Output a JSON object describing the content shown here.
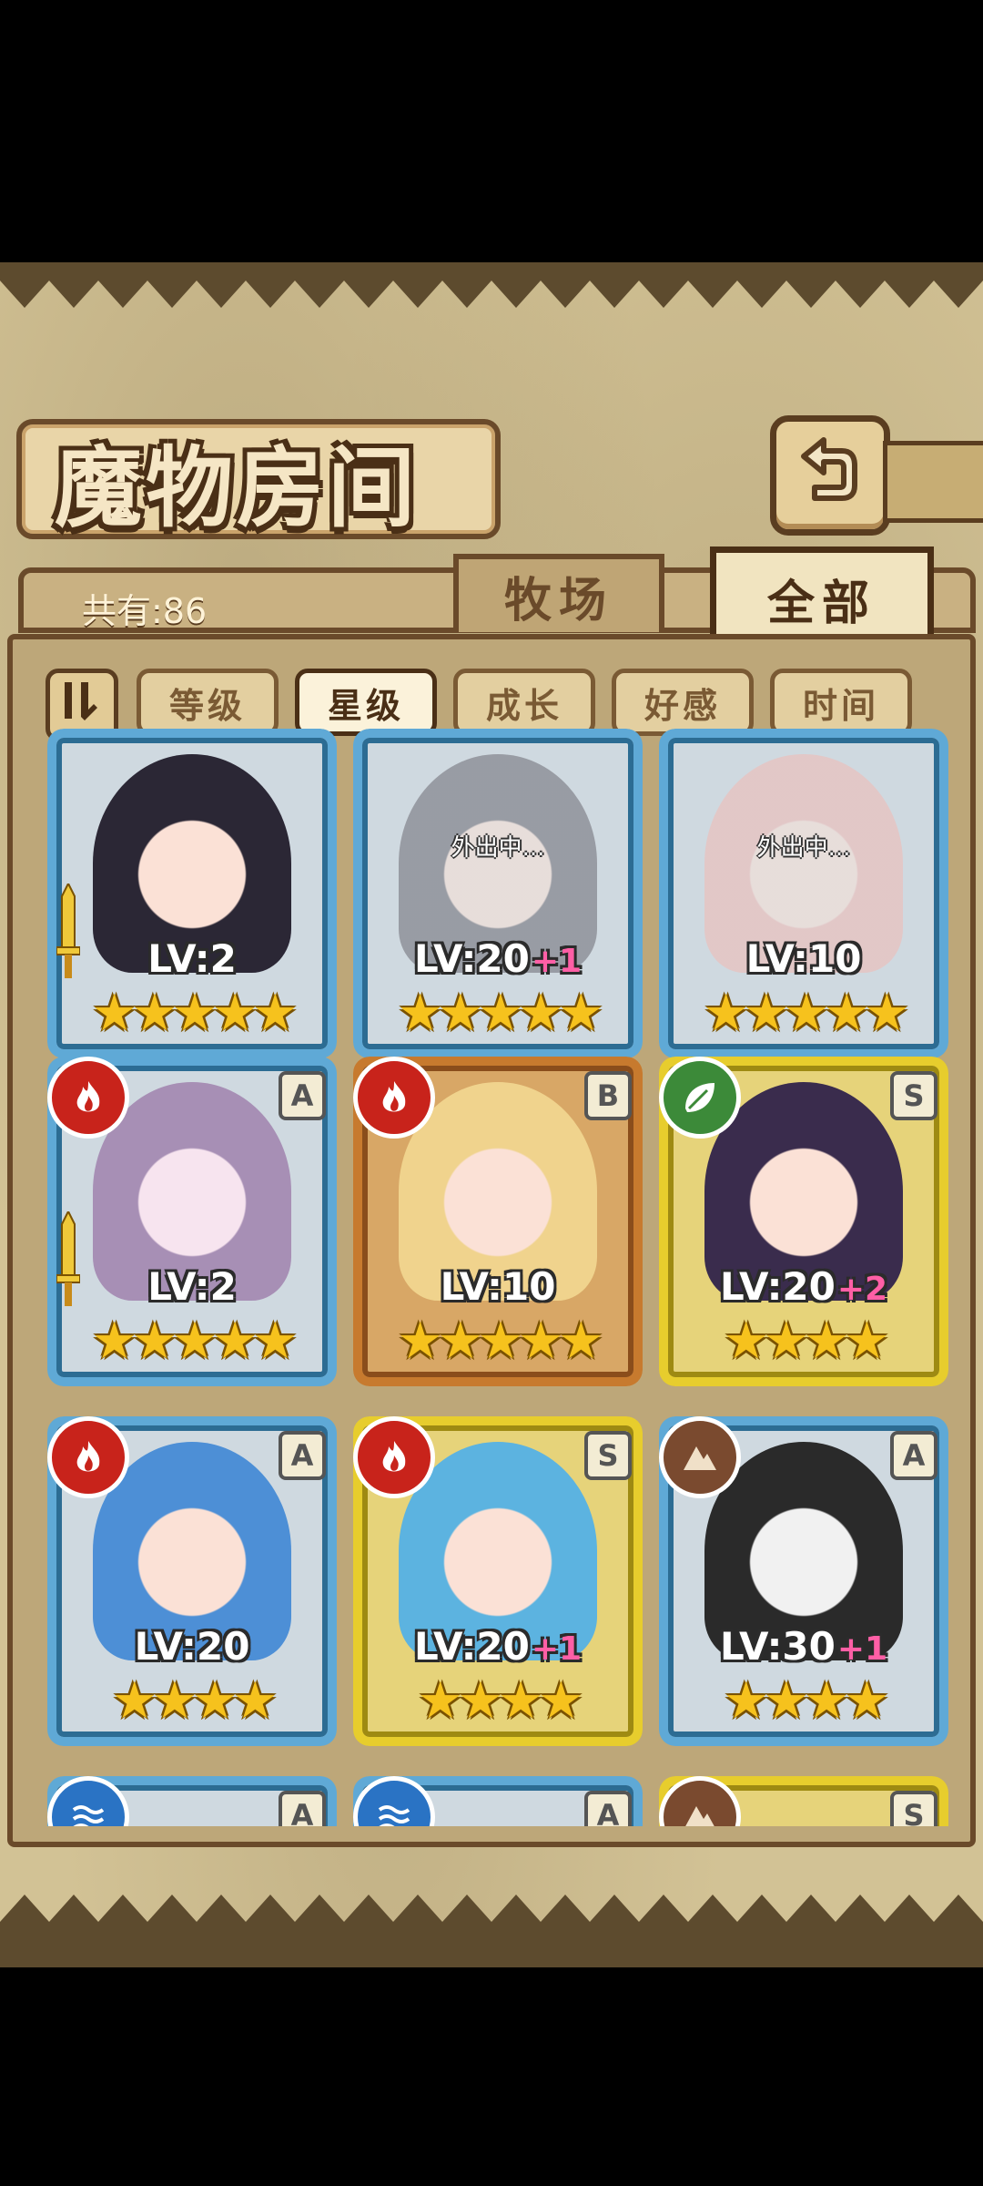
{
  "title": "魔物房间",
  "count_text": "共有:86",
  "tabs": [
    {
      "label": "牧场",
      "active": false
    },
    {
      "label": "全部",
      "active": true
    }
  ],
  "sort_buttons": [
    {
      "label": "等级",
      "active": false
    },
    {
      "label": "星级",
      "active": true
    },
    {
      "label": "成长",
      "active": false
    },
    {
      "label": "好感",
      "active": false
    },
    {
      "label": "时间",
      "active": false
    }
  ],
  "cards": [
    {
      "level": "LV:2",
      "plus": "",
      "stars": "★★★★★",
      "status": "",
      "frame": "blue",
      "element": "",
      "rank": ""
    },
    {
      "level": "LV:20",
      "plus": "+1",
      "stars": "★★★★★",
      "status": "外出中...",
      "frame": "blue",
      "element": "",
      "rank": ""
    },
    {
      "level": "LV:10",
      "plus": "",
      "stars": "★★★★★",
      "status": "外出中...",
      "frame": "blue",
      "element": "",
      "rank": ""
    },
    {
      "level": "LV:2",
      "plus": "",
      "stars": "★★★★★",
      "status": "",
      "frame": "blue",
      "element": "fire",
      "rank": "A"
    },
    {
      "level": "LV:10",
      "plus": "",
      "stars": "★★★★★",
      "status": "",
      "frame": "bronze",
      "element": "fire",
      "rank": "B"
    },
    {
      "level": "LV:20",
      "plus": "+2",
      "stars": "★★★★",
      "status": "",
      "frame": "gold",
      "element": "leaf",
      "rank": "S"
    },
    {
      "level": "LV:20",
      "plus": "",
      "stars": "★★★★",
      "status": "",
      "frame": "blue",
      "element": "fire",
      "rank": "A"
    },
    {
      "level": "LV:20",
      "plus": "+1",
      "stars": "★★★★",
      "status": "",
      "frame": "gold",
      "element": "fire",
      "rank": "S"
    },
    {
      "level": "LV:30",
      "plus": "+1",
      "stars": "★★★★",
      "status": "",
      "frame": "blue",
      "element": "rock",
      "rank": "A"
    }
  ],
  "partial_row": [
    {
      "element": "water",
      "rank": "A"
    },
    {
      "element": "water",
      "rank": "A"
    },
    {
      "element": "rock",
      "rank": "S"
    }
  ],
  "colors": {
    "fire": "#c8231b",
    "leaf": "#3c8a39",
    "rock": "#7a4a2f",
    "water": "#2a73c4",
    "plus": "#ff5fa6",
    "star": "#f6c21d"
  }
}
